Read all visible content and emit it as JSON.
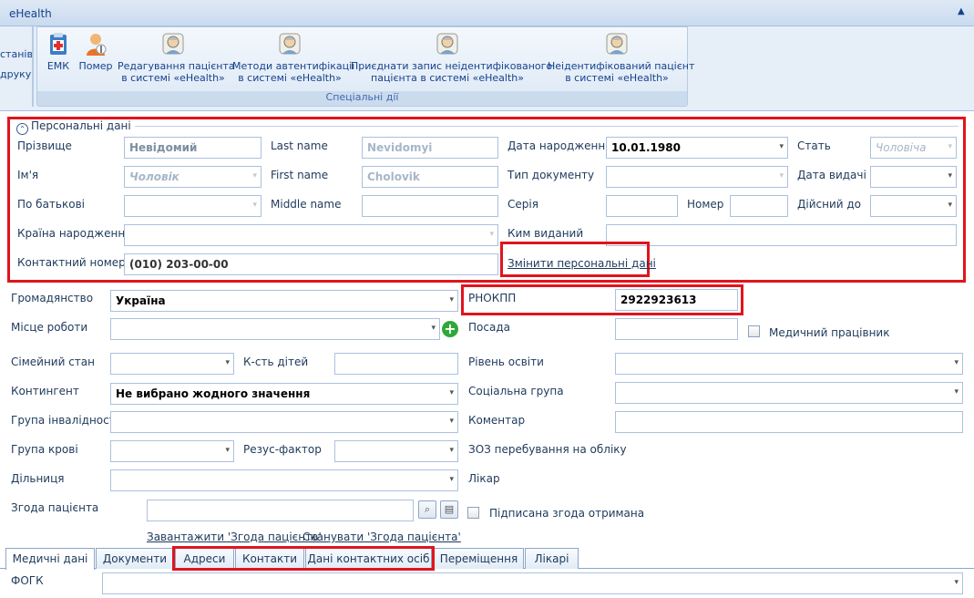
{
  "window": {
    "title": "eHealth"
  },
  "ribbon": {
    "left_cut": {
      "line1": "станів",
      "line2": "друку"
    },
    "group_caption": "Спеціальні дії",
    "buttons": [
      {
        "line1": "ЕМК",
        "line2": ""
      },
      {
        "line1": "Помер",
        "line2": ""
      },
      {
        "line1": "Редагування пацієнта",
        "line2": "в системі «eHealth»"
      },
      {
        "line1": "Методи автентифікації",
        "line2": "в системі «eHealth»"
      },
      {
        "line1": "Приєднати запис неідентифікованого",
        "line2": "пацієнта в системі «eHealth»"
      },
      {
        "line1": "Неідентифікований пацієнт",
        "line2": "в системі «eHealth»"
      }
    ]
  },
  "personal": {
    "legend": "Персональні дані",
    "surname_label": "Прізвище",
    "surname_value": "Невідомий",
    "lastname_label": "Last name",
    "lastname_value": "Nevidomyi",
    "birth_label": "Дата народження",
    "birth_value": "10.01.1980",
    "sex_label": "Стать",
    "sex_value": "Чоловіча",
    "name_label": "Ім'я",
    "name_value": "Чоловік",
    "firstname_label": "First name",
    "firstname_value": "Cholovik",
    "doctype_label": "Тип документу",
    "doctype_value": "",
    "issue_date_label": "Дата видачі",
    "patronymic_label": "По батькові",
    "middlename_label": "Middle name",
    "series_label": "Серія",
    "number_label": "Номер",
    "valid_label": "Дійсний до",
    "country_label": "Країна народження",
    "issued_by_label": "Ким виданий",
    "phone_label": "Контактний номер",
    "phone_value": "(010) 203-00-00",
    "change_link": "Змінити персональні дані"
  },
  "form": {
    "citizenship_label": "Громадянство",
    "citizenship_value": "Україна",
    "rnokpp_label": "РНОКПП",
    "rnokpp_value": "2922923613",
    "work_label": "Місце роботи",
    "position_label": "Посада",
    "medworker_label": "Медичний працівник",
    "family_label": "Сімейний стан",
    "children_label": "К-сть дітей",
    "education_label": "Рівень освіти",
    "contingent_label": "Контингент",
    "contingent_value": "Не вибрано жодного значення",
    "social_label": "Соціальна група",
    "disability_label": "Група інвалідності",
    "comment_label": "Коментар",
    "blood_label": "Група крові",
    "rh_label": "Резус-фактор",
    "zoz_label": "ЗОЗ перебування на обліку",
    "district_label": "Дільниця",
    "doctor_label": "Лікар",
    "consent_label": "Згода пацієнта",
    "consent_signed_label": "Підписана згода отримана",
    "upload_link": "Завантажити 'Згода пацієнта'",
    "scan_link": "Сканувати 'Згода пацієнта'"
  },
  "tabs": [
    "Медичні дані",
    "Документи",
    "Адреси",
    "Контакти",
    "Дані контактних осіб",
    "Переміщення",
    "Лікарі"
  ],
  "fogk_label": "ФОГК"
}
